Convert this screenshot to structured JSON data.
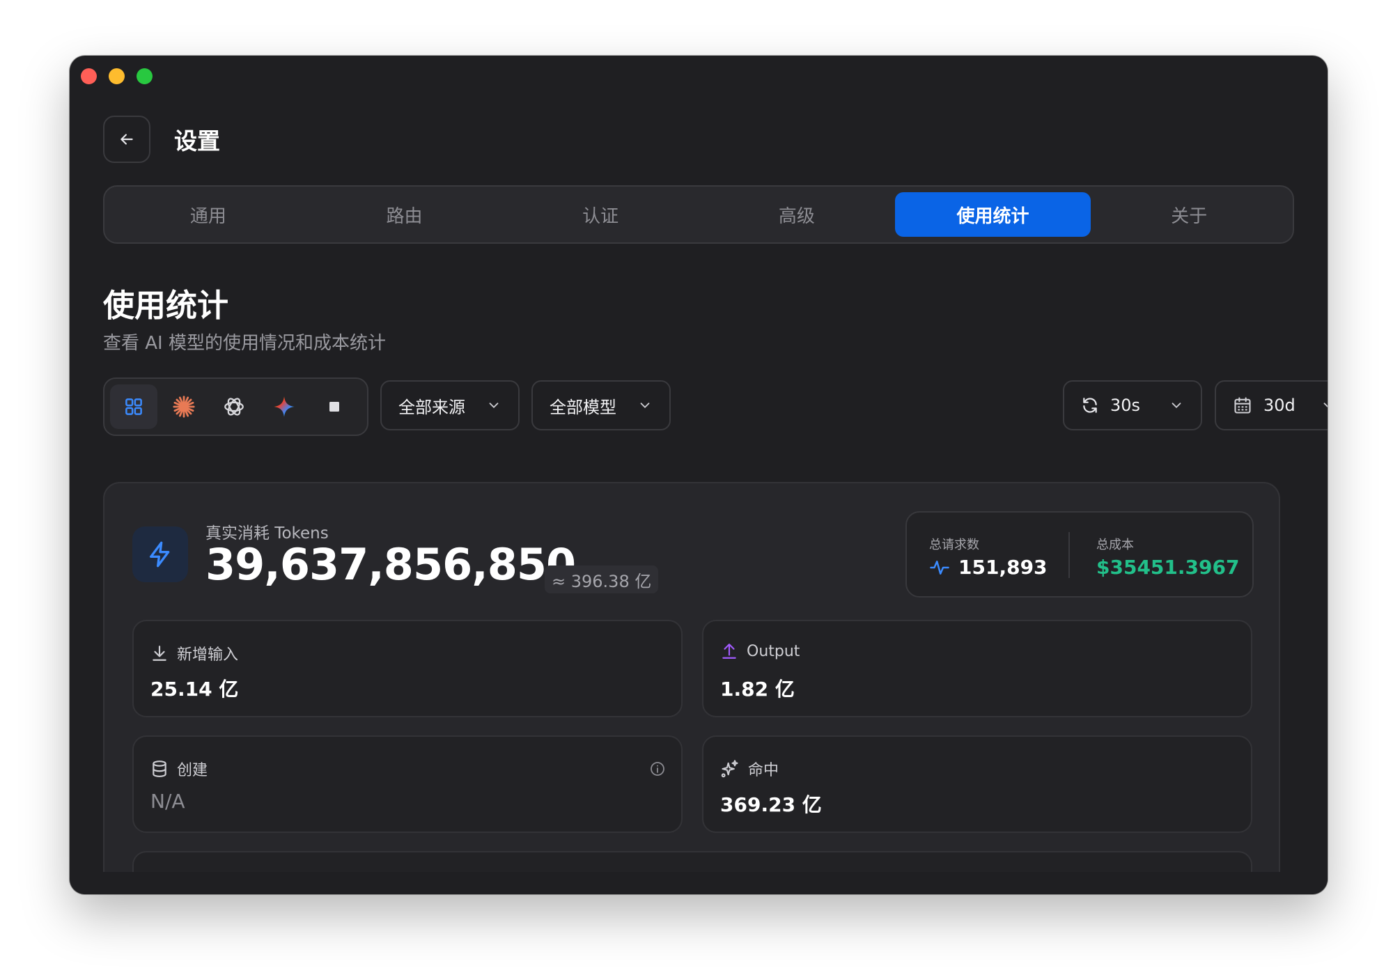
{
  "header": {
    "title": "设置"
  },
  "tabs": [
    {
      "label": "通用"
    },
    {
      "label": "路由"
    },
    {
      "label": "认证"
    },
    {
      "label": "高级"
    },
    {
      "label": "使用统计",
      "active": true
    },
    {
      "label": "关于"
    }
  ],
  "section": {
    "title": "使用统计",
    "subtitle": "查看 AI 模型的使用情况和成本统计"
  },
  "toolbar": {
    "providers": [
      "grid-icon",
      "claude-icon",
      "openai-icon",
      "gemini-icon",
      "square-icon"
    ],
    "source_label": "全部来源",
    "model_label": "全部模型",
    "refresh_label": "30s",
    "range_label": "30d"
  },
  "stats": {
    "tokens_label": "真实消耗 Tokens",
    "tokens_value": "39,637,856,850",
    "tokens_approx": "≈ 396.38 亿",
    "requests_label": "总请求数",
    "requests_value": "151,893",
    "cost_label": "总成本",
    "cost_value": "$35451.3967",
    "input_label": "新增输入",
    "input_value": "25.14 亿",
    "output_label": "Output",
    "output_value": "1.82 亿",
    "create_label": "创建",
    "create_value": "N/A",
    "hit_label": "命中",
    "hit_value": "369.23 亿"
  },
  "colors": {
    "accent": "#0a64e6",
    "cost_green": "#22c08a",
    "bolt_blue": "#3b8bff",
    "output_purple": "#a35bff"
  }
}
